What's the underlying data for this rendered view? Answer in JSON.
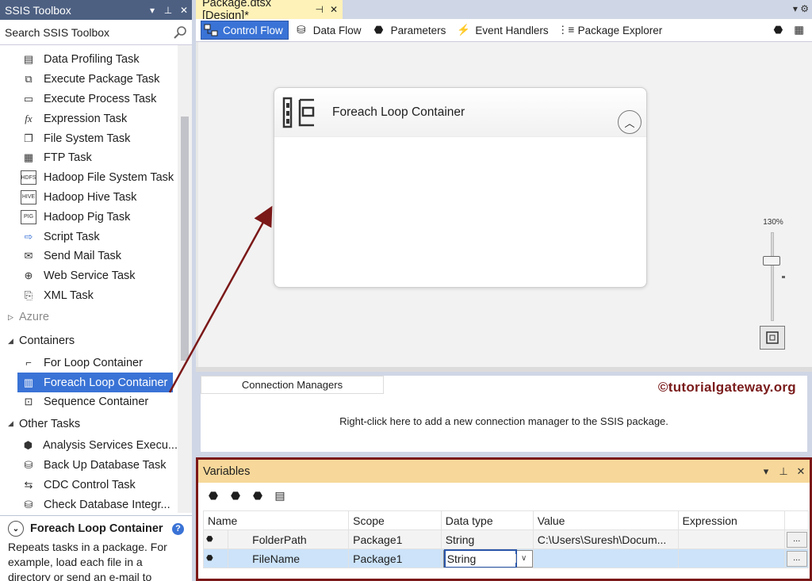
{
  "toolbox": {
    "title": "SSIS Toolbox",
    "search_placeholder": "Search SSIS Toolbox",
    "items": [
      {
        "label": "Data Profiling Task",
        "icon": "data-profiling-icon"
      },
      {
        "label": "Execute Package Task",
        "icon": "execute-package-icon"
      },
      {
        "label": "Execute Process Task",
        "icon": "execute-process-icon"
      },
      {
        "label": "Expression Task",
        "icon": "fx-icon"
      },
      {
        "label": "File System Task",
        "icon": "file-system-icon"
      },
      {
        "label": "FTP Task",
        "icon": "ftp-icon"
      },
      {
        "label": "Hadoop File System Task",
        "icon": "hdfs-icon"
      },
      {
        "label": "Hadoop Hive Task",
        "icon": "hive-icon"
      },
      {
        "label": "Hadoop Pig Task",
        "icon": "pig-icon"
      },
      {
        "label": "Script Task",
        "icon": "script-icon"
      },
      {
        "label": "Send Mail Task",
        "icon": "mail-icon"
      },
      {
        "label": "Web Service Task",
        "icon": "globe-icon"
      },
      {
        "label": "XML Task",
        "icon": "xml-icon"
      }
    ],
    "cat_azure": "Azure",
    "cat_containers": "Containers",
    "containers": [
      {
        "label": "For Loop Container"
      },
      {
        "label": "Foreach Loop Container"
      },
      {
        "label": "Sequence Container"
      }
    ],
    "cat_other": "Other Tasks",
    "other": [
      {
        "label": "Analysis Services Execu..."
      },
      {
        "label": "Back Up Database Task"
      },
      {
        "label": "CDC Control Task"
      },
      {
        "label": "Check Database Integr..."
      }
    ],
    "desc_title": "Foreach Loop Container",
    "desc_text": "Repeats tasks in a package. For example, load each file in a directory or send an e-mail to"
  },
  "designer": {
    "doc_tab": "Package.dtsx [Design]*",
    "tabs": [
      {
        "label": "Control Flow",
        "active": true
      },
      {
        "label": "Data Flow"
      },
      {
        "label": "Parameters"
      },
      {
        "label": "Event Handlers"
      },
      {
        "label": "Package Explorer"
      }
    ],
    "container_title": "Foreach Loop Container",
    "zoom": "130%",
    "conn_tab": "Connection Managers",
    "conn_hint": "Right-click here to add a new connection manager to the SSIS package.",
    "watermark": "©tutorialgateway.org"
  },
  "variables": {
    "title": "Variables",
    "columns": [
      "Name",
      "Scope",
      "Data type",
      "Value",
      "Expression"
    ],
    "rows": [
      {
        "name": "FolderPath",
        "scope": "Package1",
        "type": "String",
        "value": "C:\\Users\\Suresh\\Docum...",
        "expression": ""
      },
      {
        "name": "FileName",
        "scope": "Package1",
        "type": "String",
        "value": "",
        "expression": ""
      }
    ],
    "dots": "..."
  },
  "colors": {
    "accent": "#3a73d6",
    "highlight_border": "#7b1818",
    "arrow": "#7b1818"
  }
}
